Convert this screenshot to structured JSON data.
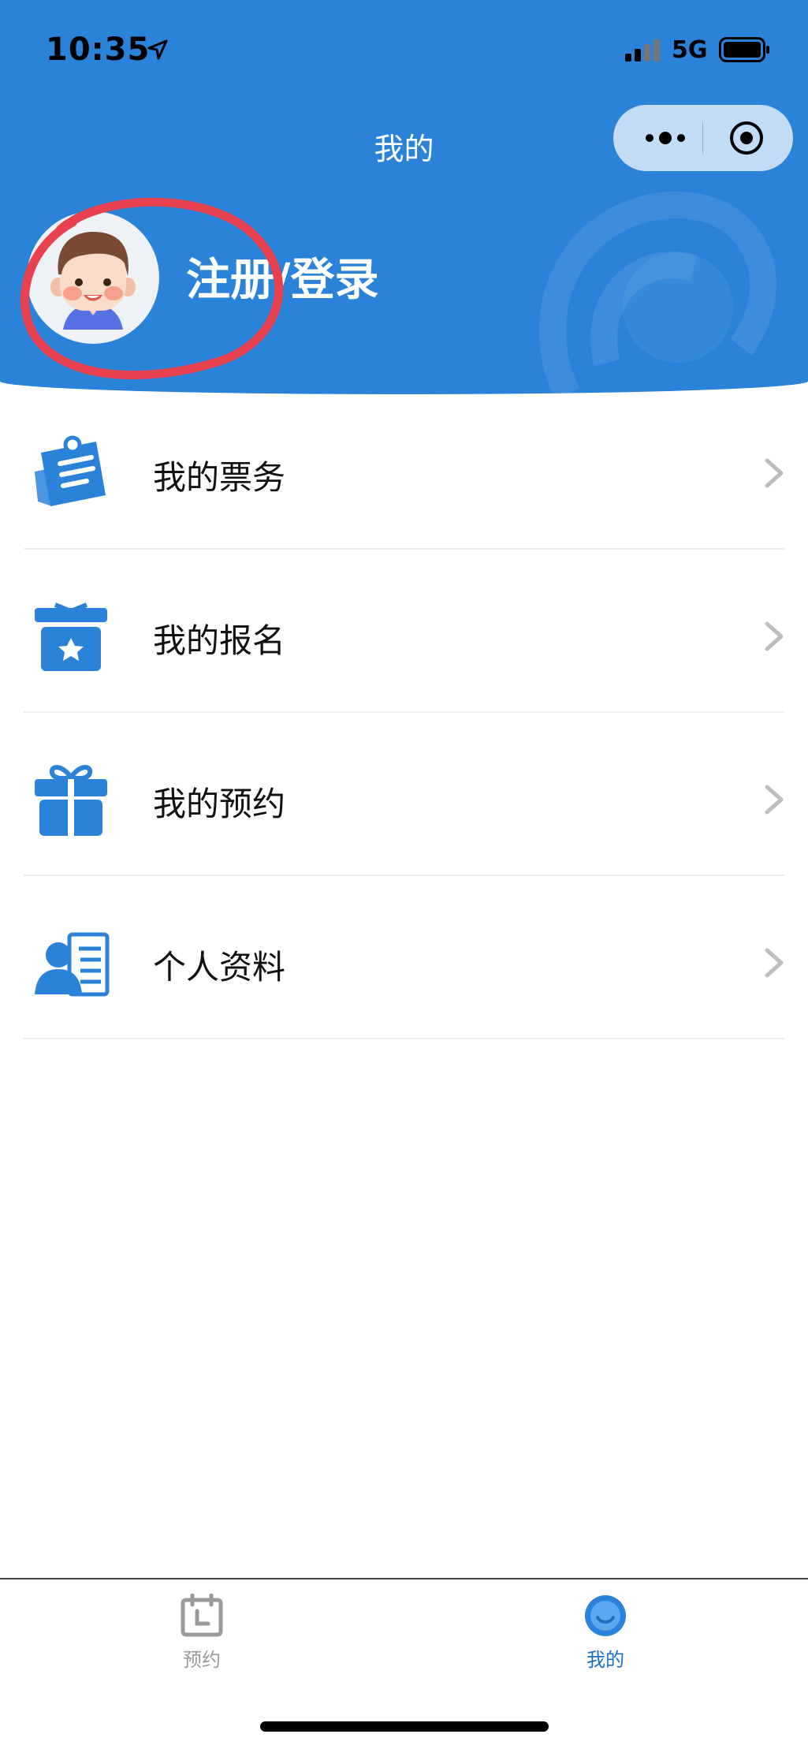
{
  "status_bar": {
    "time": "10:35",
    "network": "5G",
    "location_icon": "location-arrow-icon",
    "signal_icon": "signal-bars-icon",
    "battery_icon": "battery-icon"
  },
  "header": {
    "title": "我的",
    "login_label": "注册/登录",
    "background_color": "#2a82d9",
    "capsule": {
      "more_icon": "more-dots-icon",
      "close_icon": "target-circle-icon"
    },
    "avatar_icon": "cartoon-boy-avatar"
  },
  "menu": {
    "items": [
      {
        "label": "我的票务",
        "icon": "ticket-notes-icon"
      },
      {
        "label": "我的报名",
        "icon": "star-box-icon"
      },
      {
        "label": "我的预约",
        "icon": "gift-icon"
      },
      {
        "label": "个人资料",
        "icon": "profile-card-icon"
      }
    ],
    "chevron_icon": "chevron-right-icon",
    "icon_color": "#2a82d9"
  },
  "tabbar": {
    "tabs": [
      {
        "label": "预约",
        "icon": "calendar-icon",
        "active": false,
        "color": "#9a9a9a"
      },
      {
        "label": "我的",
        "icon": "user-circle-icon",
        "active": true,
        "color": "#1f6fc0"
      }
    ]
  },
  "annotation": {
    "color": "#e8414f",
    "shape": "hand-drawn circle around avatar"
  }
}
